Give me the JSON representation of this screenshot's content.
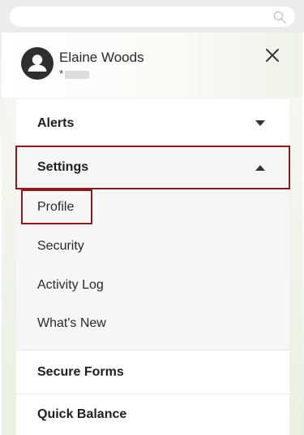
{
  "search": {
    "placeholder": "",
    "icon": "search-icon"
  },
  "user": {
    "name": "Elaine Woods",
    "sub_prefix": "*",
    "avatar_icon": "person-avatar-icon",
    "close_icon": "close-icon"
  },
  "menu": {
    "alerts": {
      "label": "Alerts",
      "state": "collapsed"
    },
    "settings": {
      "label": "Settings",
      "state": "expanded",
      "items": [
        "Profile",
        "Security",
        "Activity Log",
        "What's New"
      ]
    },
    "secure_forms": {
      "label": "Secure Forms"
    },
    "quick_balance": {
      "label": "Quick Balance"
    }
  },
  "colors": {
    "highlight_border": "#8c1c1c",
    "text": "#1f1f1f",
    "submenu_bg": "#f6f6f6"
  }
}
